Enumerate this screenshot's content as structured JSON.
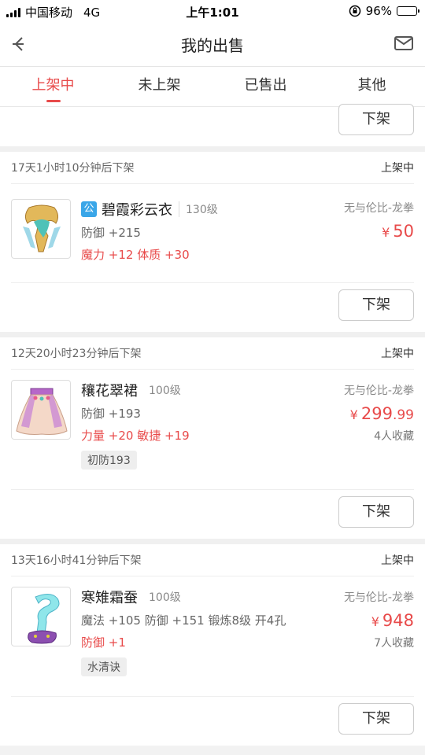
{
  "status_bar": {
    "carrier": "中国移动",
    "network": "4G",
    "time": "上午1:01",
    "battery_text": "96%",
    "battery_level": 0.96
  },
  "nav": {
    "title": "我的出售",
    "back_icon": "back-arrow-icon",
    "mail_icon": "mail-icon"
  },
  "tabs": [
    {
      "label": "上架中",
      "active": true
    },
    {
      "label": "未上架",
      "active": false
    },
    {
      "label": "已售出",
      "active": false
    },
    {
      "label": "其他",
      "active": false
    }
  ],
  "delist_label": "下架",
  "accent_color": "#e84a4a",
  "listings": [
    {
      "remaining": "17天1小时10分钟后下架",
      "status": "上架中",
      "has_public_badge": true,
      "badge": "公",
      "name": "碧霞彩云衣",
      "level": "130级",
      "attr1": "防御 +215",
      "attr2": "魔力 +12 体质 +30",
      "tag": "",
      "server": "无与伦比-龙拳",
      "price_currency": "¥",
      "price_int": "50",
      "price_dec": "",
      "favorites": ""
    },
    {
      "remaining": "12天20小时23分钟后下架",
      "status": "上架中",
      "has_public_badge": false,
      "badge": "",
      "name": "穰花翠裙",
      "level": "100级",
      "attr1": "防御 +193",
      "attr2": "力量 +20 敏捷 +19",
      "tag": "初防193",
      "server": "无与伦比-龙拳",
      "price_currency": "¥",
      "price_int": "299",
      "price_dec": ".99",
      "favorites": "4人收藏"
    },
    {
      "remaining": "13天16小时41分钟后下架",
      "status": "上架中",
      "has_public_badge": false,
      "badge": "",
      "name": "寒雉霜蚕",
      "level": "100级",
      "attr1": "魔法 +105 防御 +151 锻炼8级 开4孔",
      "attr2": "防御 +1",
      "tag": "水清诀",
      "server": "无与伦比-龙拳",
      "price_currency": "¥",
      "price_int": "948",
      "price_dec": "",
      "favorites": "7人收藏"
    }
  ]
}
